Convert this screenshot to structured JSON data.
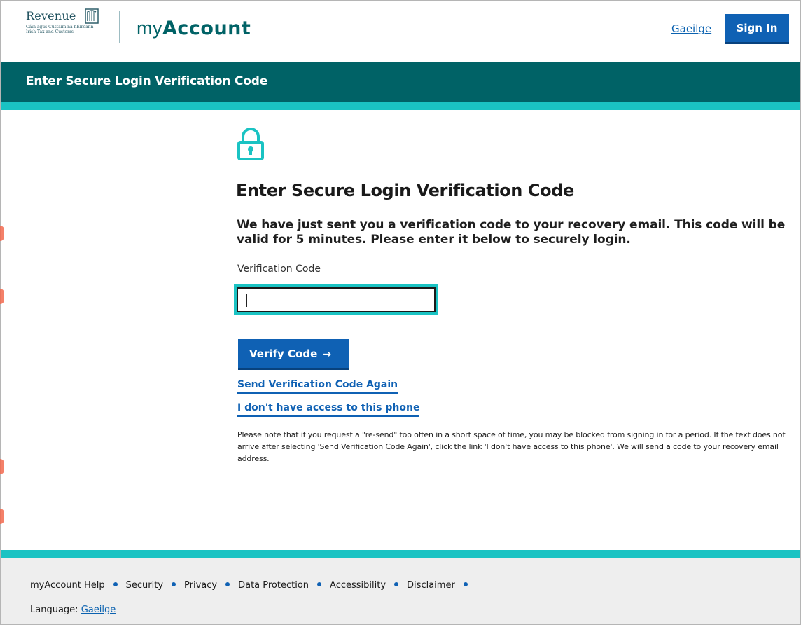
{
  "header": {
    "logo": {
      "name": "Revenue",
      "line1": "Cáin agus Custaim na hÉireann",
      "line2": "Irish Tax and Customs"
    },
    "brand": {
      "prefix": "my",
      "suffix": "Account"
    },
    "language_link": "Gaeilge",
    "sign_in_label": "Sign In"
  },
  "banner": {
    "title": "Enter Secure Login Verification Code"
  },
  "main": {
    "lock_icon": "lock-icon",
    "heading": "Enter Secure Login Verification Code",
    "lead": "We have just sent you a verification code to your recovery email. This code will be valid for 5 minutes. Please enter it below to securely login.",
    "field_label": "Verification Code",
    "field_value": "",
    "verify_button": "Verify Code",
    "verify_arrow": "→",
    "resend_link": "Send Verification Code Again",
    "no_phone_link": "I don't have access to this phone",
    "note": "Please note that if you request a \"re-send\" too often in a short space of time, you may be blocked from signing in for a period. If the text does not arrive after selecting 'Send Verification Code Again', click the link 'I don't have access to this phone'. We will send a code to your recovery email address."
  },
  "footer": {
    "links": [
      "myAccount Help",
      "Security",
      "Privacy",
      "Data Protection",
      "Accessibility",
      "Disclaimer"
    ],
    "language_prefix": "Language:",
    "language_link": "Gaeilge"
  },
  "colors": {
    "teal_dark": "#006266",
    "teal_accent": "#1ac3c3",
    "primary_blue": "#0f61b4",
    "footer_bg": "#eeeeee"
  }
}
